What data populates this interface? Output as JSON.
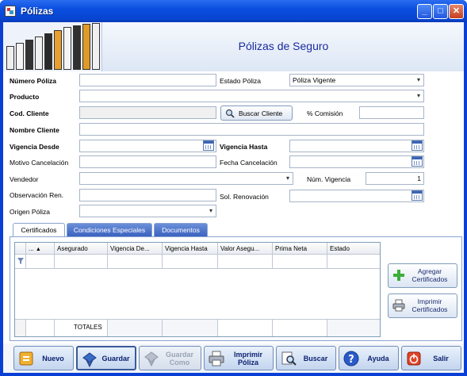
{
  "window": {
    "title": "Pólizas"
  },
  "header": {
    "title": "Pólizas de Seguro"
  },
  "form": {
    "numero_poliza_label": "Número Póliza",
    "estado_poliza_label": "Estado Póliza",
    "estado_poliza_value": "Póliza Vigente",
    "producto_label": "Producto",
    "cod_cliente_label": "Cod. Cliente",
    "buscar_cliente_label": "Buscar Cliente",
    "comision_label": "% Comisión",
    "nombre_cliente_label": "Nombre Cliente",
    "vigencia_desde_label": "Vigencia Desde",
    "vigencia_hasta_label": "Vigencia Hasta",
    "motivo_cancelacion_label": "Motivo Cancelación",
    "fecha_cancelacion_label": "Fecha Cancelación",
    "vendedor_label": "Vendedor",
    "num_vigencia_label": "Núm. Vigencia",
    "num_vigencia_value": "1",
    "observacion_ren_label": "Observación Ren.",
    "sol_renovacion_label": "Sol. Renovación",
    "origen_poliza_label": "Origen Póliza"
  },
  "tabs": [
    {
      "label": "Certificados"
    },
    {
      "label": "Condiciones Especiales"
    },
    {
      "label": "Documentos"
    }
  ],
  "grid": {
    "columns": [
      "...",
      "Asegurado",
      "Vigencia De...",
      "Vigencia Hasta",
      "Valor Asegu...",
      "Prima Neta",
      "Estado"
    ],
    "totals_label": "TOTALES"
  },
  "side_buttons": {
    "agregar": "Agregar Certificados",
    "imprimir": "Imprimir Certificados"
  },
  "toolbar": {
    "nuevo": "Nuevo",
    "guardar": "Guardar",
    "guardar_como": "Guardar Como",
    "imprimir_poliza": "Imprimir Póliza",
    "buscar": "Buscar",
    "ayuda": "Ayuda",
    "salir": "Salir"
  },
  "colors": {
    "title_blue": "#1a2b9e",
    "xp_blue": "#0a4ee0"
  }
}
